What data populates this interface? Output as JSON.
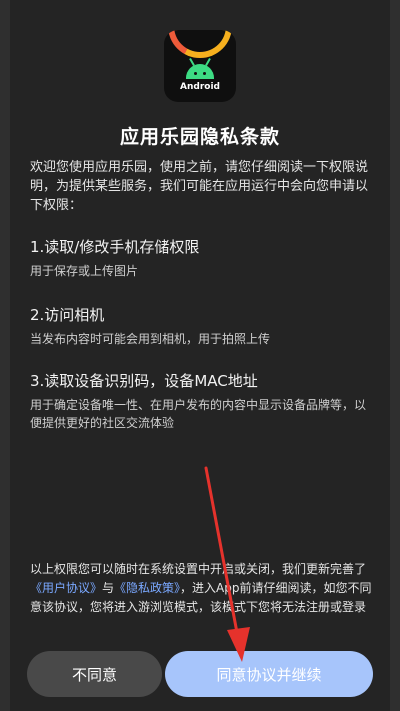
{
  "app_icon": {
    "brand_text": "Android"
  },
  "dialog": {
    "title": "应用乐园隐私条款",
    "intro": "欢迎您使用应用乐园，使用之前，请您仔细阅读一下权限说明，为提供某些服务，我们可能在应用运行中会向您申请以下权限：",
    "permissions": [
      {
        "title": "1.读取/修改手机存储权限",
        "desc": "用于保存或上传图片"
      },
      {
        "title": "2.访问相机",
        "desc": "当发布内容时可能会用到相机，用于拍照上传"
      },
      {
        "title": "3.读取设备识别码，设备MAC地址",
        "desc": "用于确定设备唯一性、在用户发布的内容中显示设备品牌等，以便提供更好的社区交流体验"
      }
    ],
    "footer": {
      "part1": "以上权限您可以随时在系统设置中开启或关闭，我们更新完善了",
      "link_user": "《用户协议》",
      "part2": "与",
      "link_privacy": "《隐私政策》",
      "part3": "，进入App前请仔细阅读，如您不同意该协议，您将进入游浏览模式，该模式下您将无法注册或登录"
    },
    "buttons": {
      "disagree": "不同意",
      "agree": "同意协议并继续"
    }
  },
  "colors": {
    "background": "#2f2f2f",
    "dialog": "#242424",
    "link": "#7aa8ff",
    "agree_button": "#a7c5fb",
    "disagree_button": "#494949",
    "annotation_arrow": "#e5322c"
  }
}
